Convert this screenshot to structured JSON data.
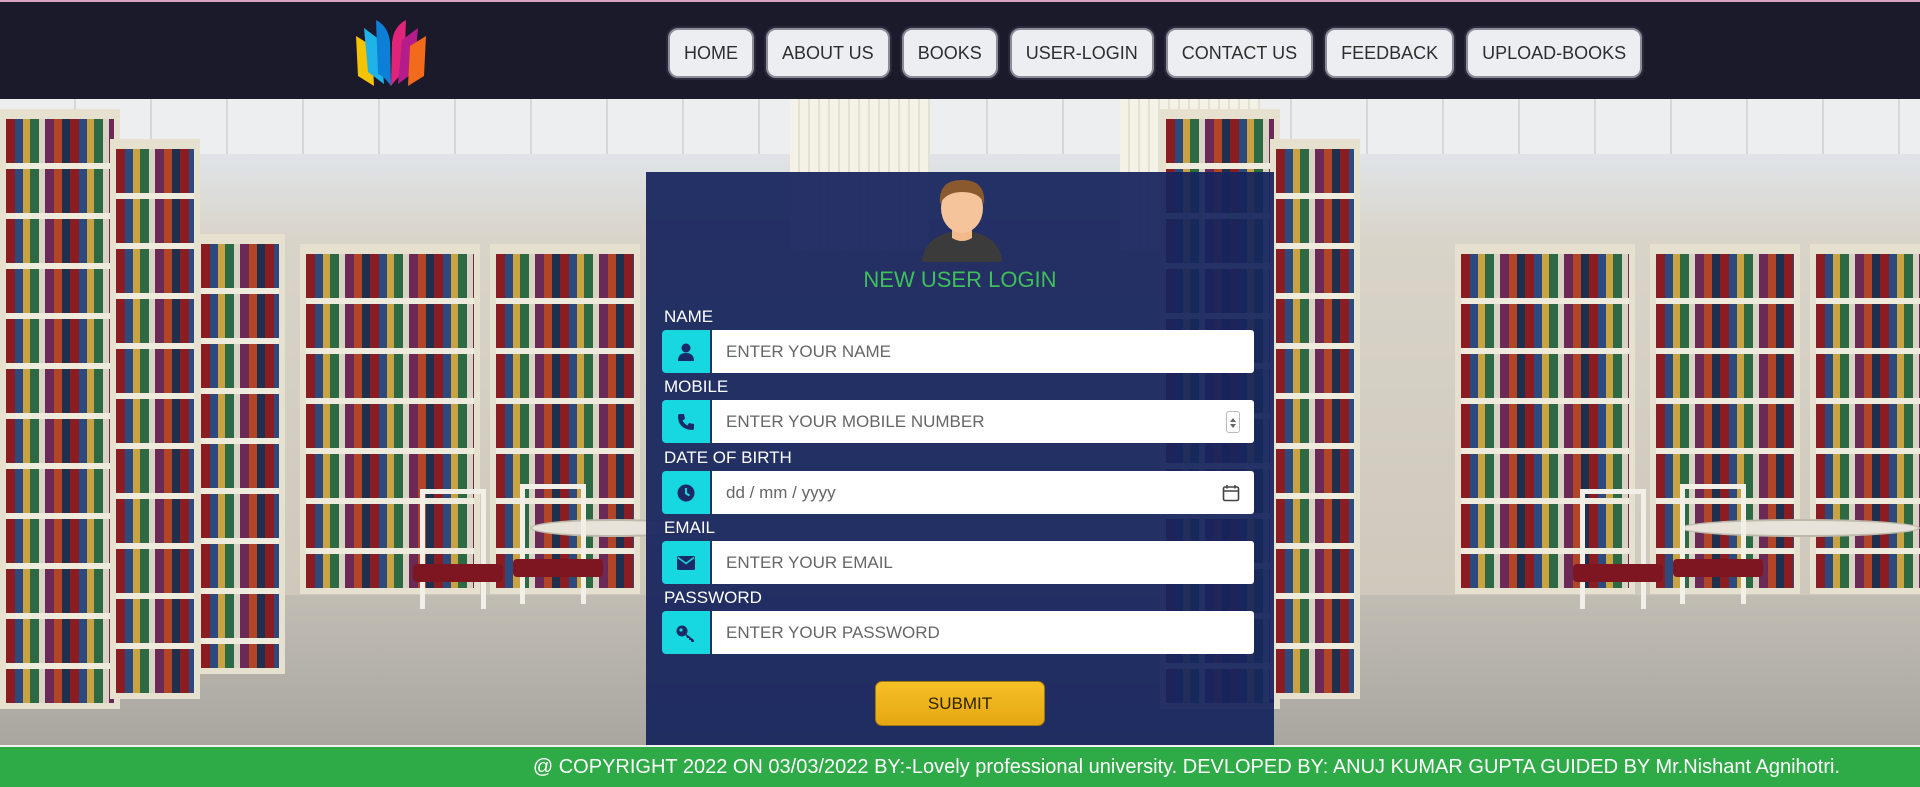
{
  "header": {
    "logo_icon": "open-book-logo-icon",
    "nav": [
      {
        "label": "HOME"
      },
      {
        "label": "ABOUT US"
      },
      {
        "label": "BOOKS"
      },
      {
        "label": "USER-LOGIN"
      },
      {
        "label": "CONTACT US"
      },
      {
        "label": "FEEDBACK"
      },
      {
        "label": "UPLOAD-BOOKS"
      }
    ]
  },
  "form": {
    "avatar_icon": "user-avatar-icon",
    "title": "NEW USER LOGIN",
    "fields": {
      "name": {
        "label": "NAME",
        "placeholder": "ENTER YOUR NAME",
        "icon": "user-icon"
      },
      "mobile": {
        "label": "MOBILE",
        "placeholder": "ENTER YOUR MOBILE NUMBER",
        "icon": "phone-icon"
      },
      "dob": {
        "label": "DATE OF BIRTH",
        "placeholder": "dd / mm / yyyy",
        "icon": "clock-icon"
      },
      "email": {
        "label": "EMAIL",
        "placeholder": "ENTER YOUR EMAIL",
        "icon": "envelope-icon"
      },
      "password": {
        "label": "PASSWORD",
        "placeholder": "ENTER YOUR PASSWORD",
        "icon": "key-icon"
      }
    },
    "submit_label": "SUBMIT"
  },
  "footer": {
    "text": "@ COPYRIGHT 2022 ON 03/03/2022 BY:-Lovely professional university. DEVLOPED BY: ANUJ KUMAR GUPTA GUIDED BY Mr.Nishant Agnihotri."
  },
  "colors": {
    "header_bg": "#1a1a2b",
    "card_bg": "#16245c",
    "title_green": "#3fbf5a",
    "icon_cyan": "#17d7e0",
    "submit_yellow": "#f5c026",
    "footer_green": "#2eaa46"
  }
}
